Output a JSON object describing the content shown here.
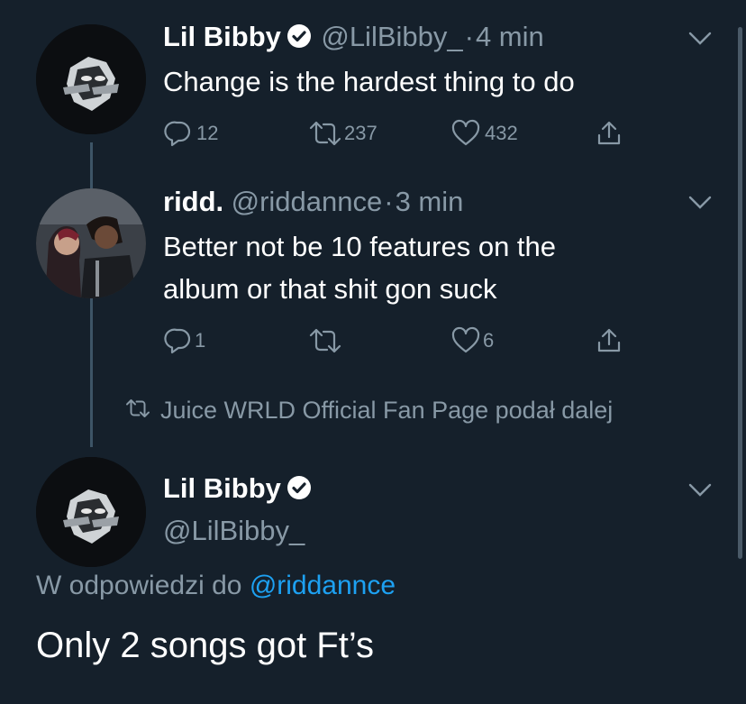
{
  "tweet1": {
    "name": "Lil Bibby",
    "handle": "@LilBibby_",
    "sep": "·",
    "time": "4 min",
    "text": "Change is the hardest thing to do",
    "replies": "12",
    "retweets": "237",
    "likes": "432"
  },
  "tweet2": {
    "name": "ridd.",
    "handle": "@riddannce",
    "sep": "·",
    "time": "3 min",
    "text_line1": "Better not be 10 features on the",
    "text_line2": "album or that shit gon suck",
    "replies": "1",
    "likes": "6"
  },
  "retweet_notice": "Juice WRLD Official Fan Page podał dalej",
  "main_tweet": {
    "name": "Lil Bibby",
    "handle": "@LilBibby_",
    "reply_prefix": "W odpowiedzi do",
    "reply_to": "@riddannce",
    "text": "Only 2 songs got Ft’s"
  },
  "icons": [
    "verified-badge-icon",
    "reply-icon",
    "retweet-icon",
    "like-icon",
    "share-icon",
    "chevron-down-icon"
  ],
  "colors": {
    "background": "#15202b",
    "secondary_text": "#8899a6",
    "link": "#1da1f2",
    "thread_line": "#3d5466"
  }
}
